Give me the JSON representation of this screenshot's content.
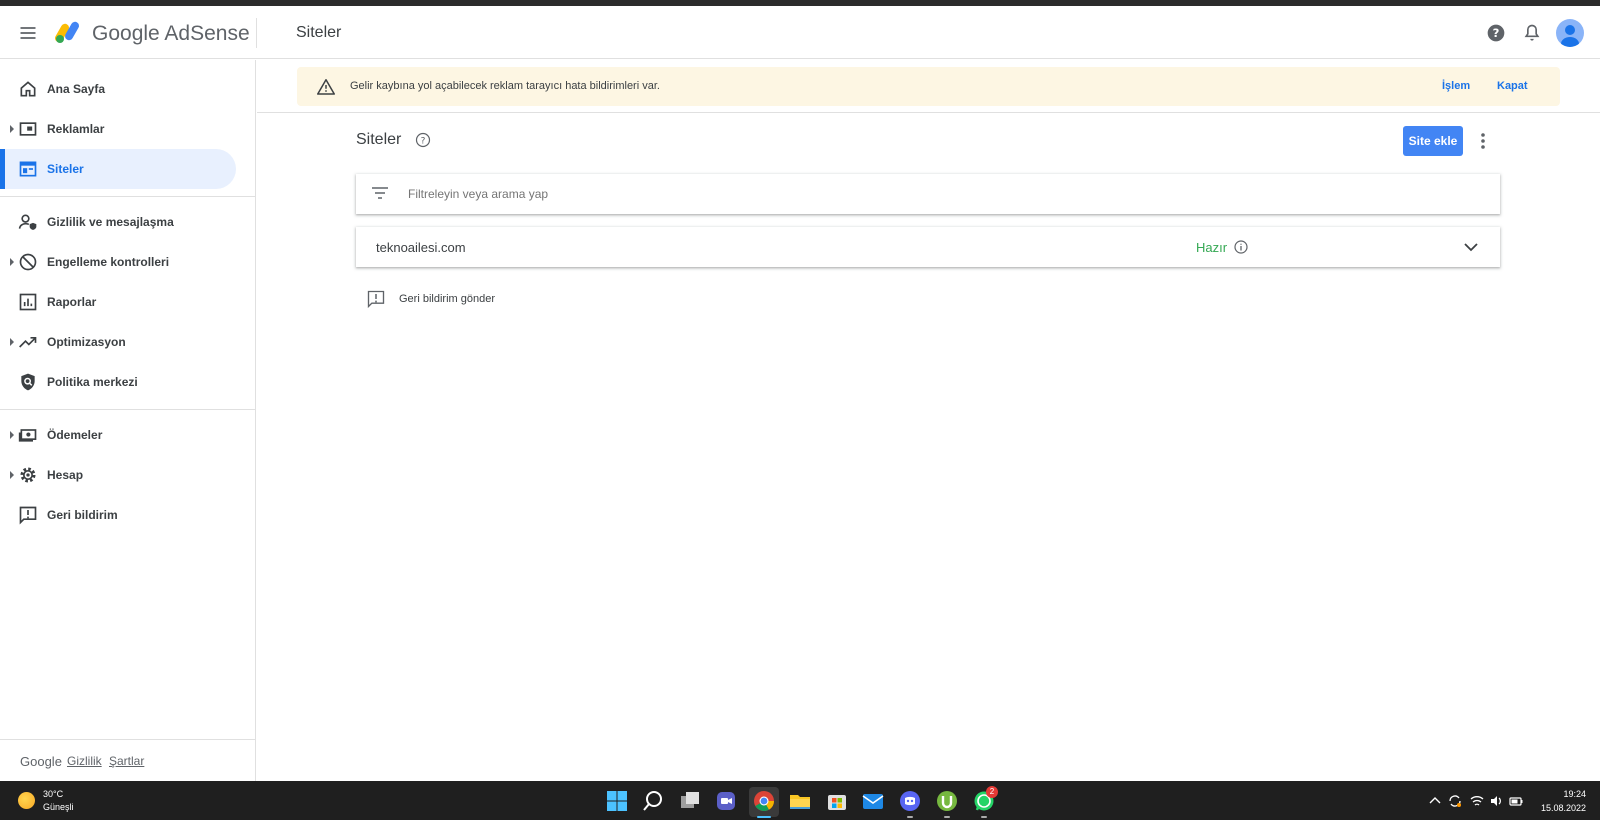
{
  "header": {
    "product_name": "Google AdSense",
    "page_title": "Siteler"
  },
  "sidebar": {
    "items": [
      {
        "label": "Ana Sayfa",
        "icon": "home-icon",
        "expandable": false,
        "active": false
      },
      {
        "label": "Reklamlar",
        "icon": "ads-icon",
        "expandable": true,
        "active": false
      },
      {
        "label": "Siteler",
        "icon": "sites-icon",
        "expandable": false,
        "active": true
      },
      {
        "label": "Gizlilik ve mesajlaşma",
        "icon": "privacy-icon",
        "expandable": false,
        "active": false
      },
      {
        "label": "Engelleme kontrolleri",
        "icon": "block-icon",
        "expandable": true,
        "active": false
      },
      {
        "label": "Raporlar",
        "icon": "reports-icon",
        "expandable": false,
        "active": false
      },
      {
        "label": "Optimizasyon",
        "icon": "trending-icon",
        "expandable": true,
        "active": false
      },
      {
        "label": "Politika merkezi",
        "icon": "policy-shield-icon",
        "expandable": false,
        "active": false
      },
      {
        "label": "Ödemeler",
        "icon": "payments-icon",
        "expandable": true,
        "active": false
      },
      {
        "label": "Hesap",
        "icon": "gear-icon",
        "expandable": true,
        "active": false
      },
      {
        "label": "Geri bildirim",
        "icon": "feedback-icon",
        "expandable": false,
        "active": false
      }
    ],
    "footer": {
      "brand": "Google",
      "privacy_link": "Gizlilik",
      "terms_link": "Şartlar"
    }
  },
  "banner": {
    "message": "Gelir kaybına yol açabilecek reklam tarayıcı hata bildirimleri var.",
    "action_label": "İşlem",
    "close_label": "Kapat"
  },
  "main": {
    "title": "Siteler",
    "add_site_label": "Site ekle",
    "filter_placeholder": "Filtreleyin veya arama yap",
    "sites": [
      {
        "domain": "teknoailesi.com",
        "status": "Hazır"
      }
    ],
    "feedback_label": "Geri bildirim gönder"
  },
  "taskbar": {
    "weather_temp": "30°C",
    "weather_desc": "Güneşli",
    "whatsapp_badge": "2",
    "time": "19:24",
    "date": "15.08.2022"
  },
  "colors": {
    "accent": "#1a73e8",
    "button": "#4285f4",
    "status_ready": "#34a853",
    "banner_bg": "#fdf6e3"
  }
}
